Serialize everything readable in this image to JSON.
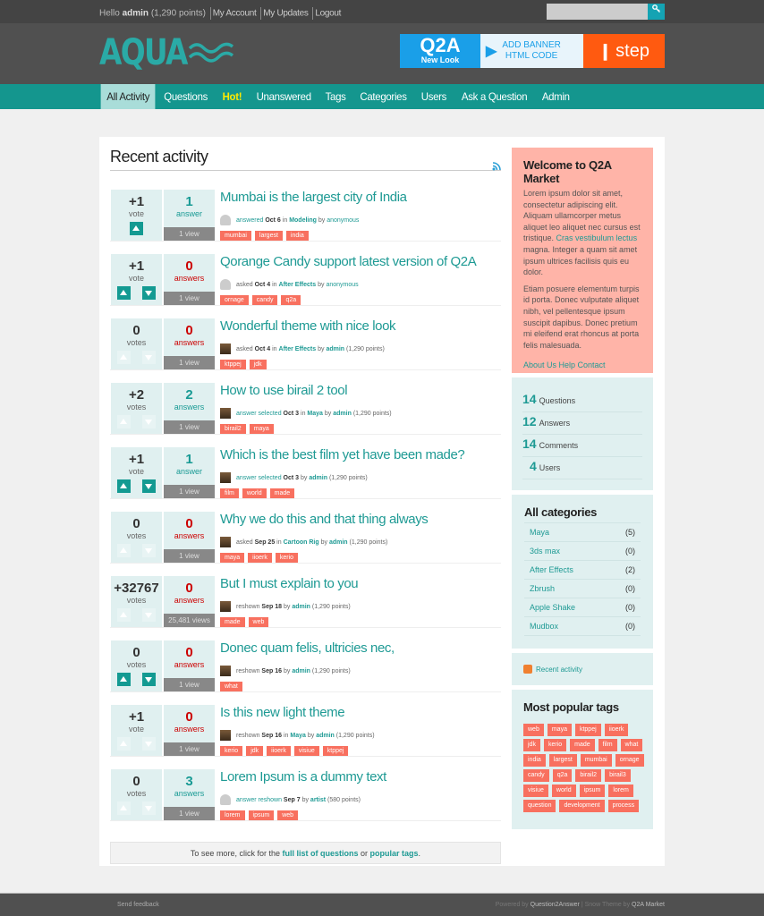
{
  "topbar": {
    "greeting": "Hello",
    "username": "admin",
    "points": "(1,290 points)",
    "links": [
      "My Account",
      "My Updates",
      "Logout"
    ],
    "search": {
      "value": "",
      "placeholder": "",
      "icon": "key-search-icon"
    }
  },
  "header": {
    "logo": "AQUA",
    "banner": {
      "line1": "Q2A",
      "line2": "New Look",
      "cta1": "ADD BANNER",
      "cta2": "HTML CODE",
      "brand": "step"
    }
  },
  "nav": {
    "items": [
      {
        "label": "All Activity",
        "active": true
      },
      {
        "label": "Questions"
      },
      {
        "label": "Hot!",
        "hot": true
      },
      {
        "label": "Unanswered"
      },
      {
        "label": "Tags"
      },
      {
        "label": "Categories"
      },
      {
        "label": "Users"
      },
      {
        "label": "Ask a Question"
      },
      {
        "label": "Admin"
      }
    ]
  },
  "main": {
    "title": "Recent activity",
    "questions": [
      {
        "votes": "+1",
        "vote_label": "vote",
        "arrows": "up-only",
        "answers": "1",
        "answer_label": "answer",
        "views": "1 view",
        "title": "Mumbai is the largest city of India",
        "avatar": "user",
        "action": "answered",
        "when": "Oct 6",
        "in": "in",
        "category": "Modeling",
        "by": "by",
        "who": "anonymous",
        "who_points": "",
        "tags": [
          "mumbai",
          "largest",
          "india"
        ]
      },
      {
        "votes": "+1",
        "vote_label": "vote",
        "arrows": "on",
        "answers": "0",
        "answer_label": "answers",
        "views": "1 view",
        "title": "Qorange Candy support latest version of Q2A",
        "avatar": "user",
        "action": "asked",
        "when": "Oct 4",
        "in": "in",
        "category": "After Effects",
        "by": "by",
        "who": "anonymous",
        "who_points": "",
        "tags": [
          "ornage",
          "candy",
          "q2a"
        ]
      },
      {
        "votes": "0",
        "vote_label": "votes",
        "arrows": "off",
        "answers": "0",
        "answer_label": "answers",
        "views": "1 view",
        "title": "Wonderful theme with nice look",
        "avatar": "img",
        "action": "asked",
        "when": "Oct 4",
        "in": "in",
        "category": "After Effects",
        "by": "by",
        "who": "admin",
        "who_points": "(1,290 points)",
        "tags": [
          "ktppej",
          "jdk"
        ]
      },
      {
        "votes": "+2",
        "vote_label": "votes",
        "arrows": "off",
        "answers": "2",
        "answer_label": "answers",
        "views": "1 view",
        "title": "How to use birail 2 tool",
        "avatar": "img",
        "action": "answer selected",
        "when": "Oct 3",
        "in": "in",
        "category": "Maya",
        "by": "by",
        "who": "admin",
        "who_points": "(1,290 points)",
        "tags": [
          "birail2",
          "maya"
        ]
      },
      {
        "votes": "+1",
        "vote_label": "vote",
        "arrows": "on",
        "answers": "1",
        "answer_label": "answer",
        "views": "1 view",
        "title": "Which is the best film yet have been made?",
        "avatar": "img",
        "action": "answer selected",
        "when": "Oct 3",
        "in": "",
        "category": "",
        "by": "by",
        "who": "admin",
        "who_points": "(1,290 points)",
        "tags": [
          "film",
          "world",
          "made"
        ]
      },
      {
        "votes": "0",
        "vote_label": "votes",
        "arrows": "off",
        "answers": "0",
        "answer_label": "answers",
        "views": "1 view",
        "title": "Why we do this and that thing always",
        "avatar": "img",
        "action": "asked",
        "when": "Sep 25",
        "in": "in",
        "category": "Cartoon Rig",
        "by": "by",
        "who": "admin",
        "who_points": "(1,290 points)",
        "tags": [
          "maya",
          "iioerk",
          "kerio"
        ]
      },
      {
        "votes": "+32767",
        "vote_label": "votes",
        "arrows": "off",
        "answers": "0",
        "answer_label": "answers",
        "views": "25,481 views",
        "title": "But I must explain to you",
        "avatar": "img",
        "action": "reshown",
        "when": "Sep 18",
        "in": "",
        "category": "",
        "by": "by",
        "who": "admin",
        "who_points": "(1,290 points)",
        "tags": [
          "made",
          "web"
        ]
      },
      {
        "votes": "0",
        "vote_label": "votes",
        "arrows": "on",
        "answers": "0",
        "answer_label": "answers",
        "views": "1 view",
        "title": "Donec quam felis, ultricies nec,",
        "avatar": "img",
        "action": "reshown",
        "when": "Sep 16",
        "in": "",
        "category": "",
        "by": "by",
        "who": "admin",
        "who_points": "(1,290 points)",
        "tags": [
          "what"
        ]
      },
      {
        "votes": "+1",
        "vote_label": "vote",
        "arrows": "off",
        "answers": "0",
        "answer_label": "answers",
        "views": "1 view",
        "title": "Is this new light theme",
        "avatar": "img",
        "action": "reshown",
        "when": "Sep 16",
        "in": "in",
        "category": "Maya",
        "by": "by",
        "who": "admin",
        "who_points": "(1,290 points)",
        "tags": [
          "kerio",
          "jdk",
          "iioerk",
          "visiue",
          "ktppej"
        ]
      },
      {
        "votes": "0",
        "vote_label": "votes",
        "arrows": "off",
        "answers": "3",
        "answer_label": "answers",
        "views": "1 view",
        "title": "Lorem Ipsum is a dummy text",
        "avatar": "user",
        "action": "answer reshown",
        "when": "Sep 7",
        "in": "",
        "category": "",
        "by": "by",
        "who": "artist",
        "who_points": "(580 points)",
        "tags": [
          "lorem",
          "ipsum",
          "web"
        ]
      }
    ],
    "suggest": {
      "pre": "To see more, click for the",
      "link1": "full list of questions",
      "mid": "or",
      "link2": "popular tags",
      "post": "."
    }
  },
  "sidebar": {
    "welcome": {
      "title": "Welcome to Q2A Market",
      "p1_pre": "Lorem ipsum dolor sit amet, consectetur adipiscing elit. Aliquam ullamcorper metus aliquet leo aliquet nec cursus est tristique.",
      "p1_link": "Cras vestibulum lectus",
      "p1_post": "magna. Integer a quam sit amet ipsum ultrices facilisis quis eu dolor.",
      "p2": "Etiam posuere elementum turpis id porta. Donec vulputate aliquet nibh, vel pellentesque ipsum suscipit dapibus. Donec pretium mi eleifend erat rhoncus at porta felis malesuada.",
      "links": "About Us Help Contact"
    },
    "stats": [
      {
        "num": "14",
        "label": "Questions"
      },
      {
        "num": "12",
        "label": "Answers"
      },
      {
        "num": "14",
        "label": "Comments"
      },
      {
        "num": "4",
        "label": "Users"
      }
    ],
    "categories_title": "All categories",
    "categories": [
      {
        "name": "Maya",
        "count": "(5)"
      },
      {
        "name": "3ds max",
        "count": "(0)"
      },
      {
        "name": "After Effects",
        "count": "(2)"
      },
      {
        "name": "Zbrush",
        "count": "(0)"
      },
      {
        "name": "Apple Shake",
        "count": "(0)"
      },
      {
        "name": "Mudbox",
        "count": "(0)"
      }
    ],
    "feed_label": "Recent activity",
    "tags_title": "Most popular tags",
    "tags": [
      "web",
      "maya",
      "ktppej",
      "iioerk",
      "jdk",
      "kerio",
      "made",
      "film",
      "what",
      "india",
      "largest",
      "mumbai",
      "ornage",
      "candy",
      "q2a",
      "birail2",
      "birail3",
      "visiue",
      "world",
      "ipsum",
      "lorem",
      "question",
      "development",
      "process"
    ]
  },
  "footer": {
    "left": "Send feedback",
    "powered": "Powered by",
    "q2a": "Question2Answer",
    "theme": "| Snow Theme by",
    "market": "Q2A Market"
  },
  "colors": {
    "accent": "#14968e",
    "link": "#1e9a94",
    "tag": "#f8705f",
    "welcome_bg": "#ffb4a8",
    "panel_bg": "#e0f0f0",
    "zero_answers": "#cc0000"
  }
}
